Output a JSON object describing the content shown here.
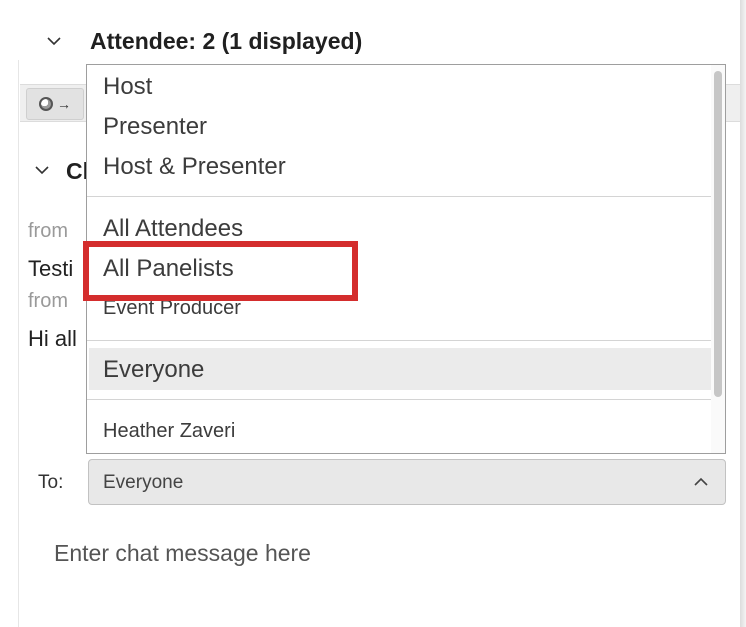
{
  "attendee_panel": {
    "title": "Attendee: 2 (1 displayed)"
  },
  "chat_panel": {
    "title_partial": "Cl",
    "messages": [
      {
        "from_partial": "from",
        "text_partial": "Testi"
      },
      {
        "from_partial": "from",
        "text_partial": "Hi all"
      }
    ]
  },
  "recipient_dropdown": {
    "items": [
      {
        "label": "Host"
      },
      {
        "label": "Presenter"
      },
      {
        "label": "Host & Presenter"
      },
      {
        "label": "All Attendees"
      },
      {
        "label": "All Panelists"
      },
      {
        "label": "Event Producer"
      },
      {
        "label": "Everyone"
      },
      {
        "label": "Heather Zaveri"
      }
    ],
    "selected": "Everyone",
    "highlighted": "All Panelists",
    "highlight_color": "#d42d2d"
  },
  "to_row": {
    "label": "To:",
    "value": "Everyone"
  },
  "message_input": {
    "placeholder": "Enter chat message here"
  }
}
